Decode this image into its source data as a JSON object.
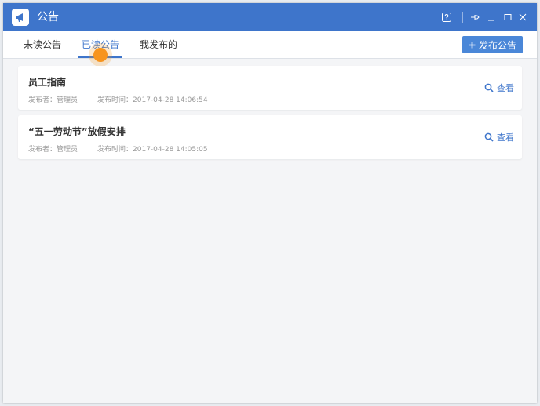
{
  "window": {
    "title": "公告"
  },
  "tabs": [
    {
      "label": "未读公告"
    },
    {
      "label": "已读公告"
    },
    {
      "label": "我发布的"
    }
  ],
  "publish_button": {
    "label": "发布公告"
  },
  "notices": [
    {
      "title": "员工指南",
      "publisher_label": "发布者：",
      "publisher": "管理员",
      "time_label": "发布时间：",
      "time": "2017-04-28 14:06:54",
      "view_label": "查看"
    },
    {
      "title": "“五一劳动节”放假安排",
      "publisher_label": "发布者：",
      "publisher": "管理员",
      "time_label": "发布时间：",
      "time": "2017-04-28 14:05:05",
      "view_label": "查看"
    }
  ],
  "colors": {
    "primary": "#3e75cb",
    "button": "#4a87d8",
    "cursor": "#f7941d"
  },
  "icons": [
    "megaphone-icon",
    "help-icon",
    "pin-icon",
    "minimize-icon",
    "maximize-icon",
    "close-icon",
    "plus-icon",
    "search-icon"
  ]
}
